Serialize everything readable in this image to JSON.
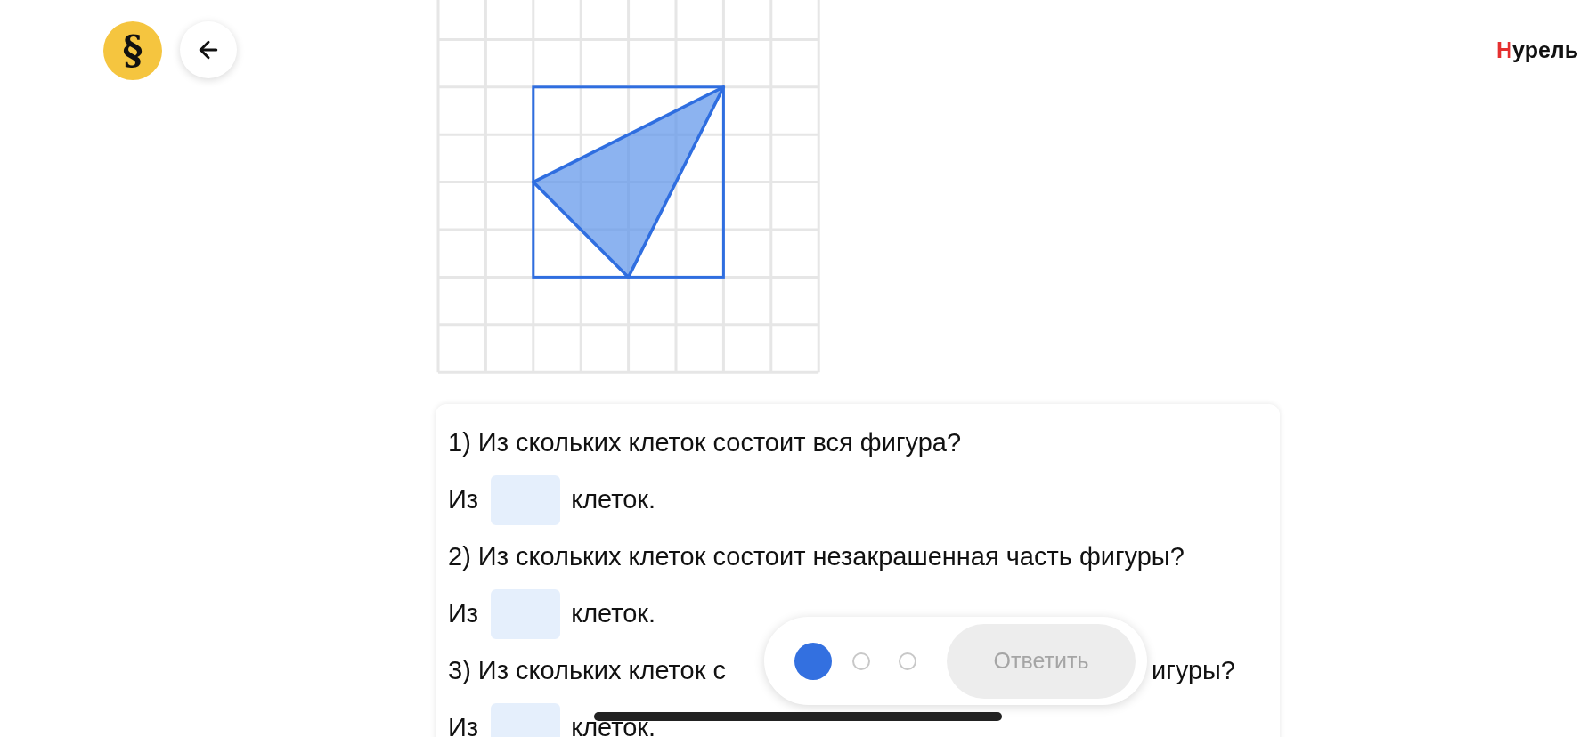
{
  "header": {
    "logo": "§",
    "user_name": "Нурель"
  },
  "questions": [
    {
      "parts": [
        "1) Из скольких клеток состоит вся фигура?"
      ],
      "answer": {
        "prefix": "Из",
        "suffix": "клеток."
      }
    },
    {
      "parts": [
        "2) Из скольких клеток состоит незакрашенная часть фигуры?"
      ],
      "answer": {
        "prefix": "Из",
        "suffix": "клеток."
      }
    },
    {
      "parts": [
        "3) Из скольких клеток с",
        "игуры?"
      ],
      "answer": {
        "prefix": "Из",
        "suffix": "клеток."
      }
    }
  ],
  "footer": {
    "steps": [
      {
        "selected": true
      },
      {
        "selected": false
      },
      {
        "selected": false
      }
    ],
    "submit": {
      "label": "Ответить",
      "disabled": true
    }
  }
}
